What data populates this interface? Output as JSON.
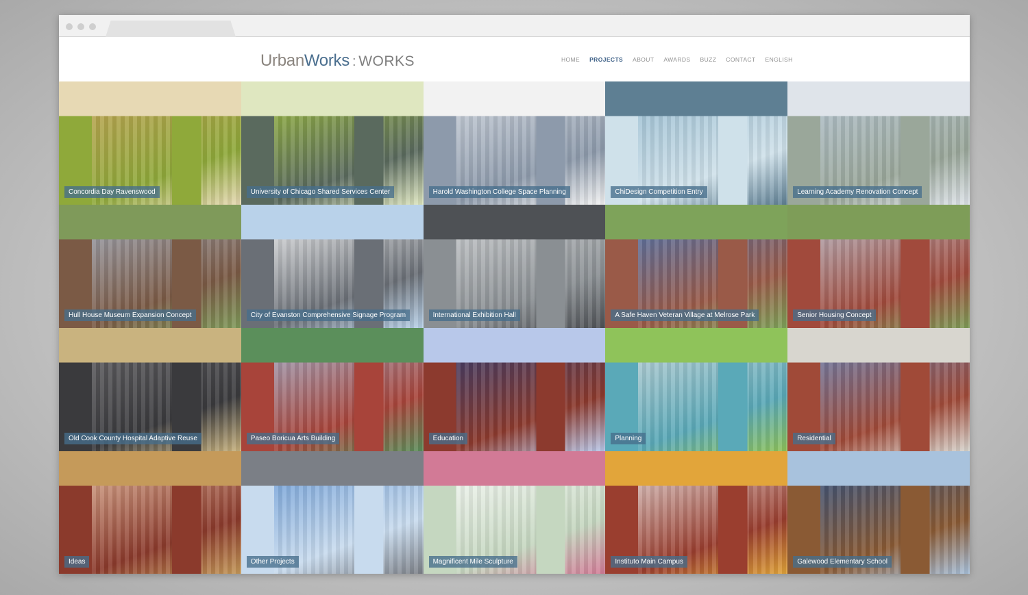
{
  "header": {
    "logo_urban": "Urban",
    "logo_works": "Works",
    "logo_sep": ":",
    "logo_sub": "WORKS"
  },
  "nav": [
    {
      "label": "HOME",
      "active": false
    },
    {
      "label": "PROJECTS",
      "active": true
    },
    {
      "label": "ABOUT",
      "active": false
    },
    {
      "label": "AWARDS",
      "active": false
    },
    {
      "label": "BUZZ",
      "active": false
    },
    {
      "label": "CONTACT",
      "active": false
    },
    {
      "label": "ENGLISH",
      "active": false
    }
  ],
  "projects": [
    {
      "label": "Concordia Day Ravenswood",
      "icon": "interior-classroom-image",
      "colors": [
        "#c9a15a",
        "#8fa93a",
        "#e7d9b4"
      ]
    },
    {
      "label": "University of Chicago Shared Services Center",
      "icon": "interior-office-image",
      "colors": [
        "#a6c83a",
        "#5a6a5e",
        "#dfe7c0"
      ]
    },
    {
      "label": "Harold Washington College Space Planning",
      "icon": "tower-building-image",
      "colors": [
        "#d8dde4",
        "#8d9aab",
        "#f2f2f2"
      ]
    },
    {
      "label": "ChiDesign Competition Entry",
      "icon": "plaza-rendering-image",
      "colors": [
        "#8fb6cc",
        "#cfe1ea",
        "#5e7f93"
      ]
    },
    {
      "label": "Learning Academy Renovation Concept",
      "icon": "school-building-image",
      "colors": [
        "#b7c7d8",
        "#9aa79a",
        "#dfe4ea"
      ]
    },
    {
      "label": "Hull House Museum Expansion Concept",
      "icon": "museum-building-image",
      "colors": [
        "#a3b3c8",
        "#7b5a45",
        "#7f9a5a"
      ]
    },
    {
      "label": "City of Evanston Comprehensive Signage Program",
      "icon": "signage-drawing-image",
      "colors": [
        "#ffffff",
        "#6a6f76",
        "#b9d2ea"
      ]
    },
    {
      "label": "International Exhibition Hall",
      "icon": "exhibition-hall-image",
      "colors": [
        "#d6d8da",
        "#8a8f93",
        "#4e5155"
      ]
    },
    {
      "label": "A Safe Haven Veteran Village at Melrose Park",
      "icon": "housing-village-image",
      "colors": [
        "#3f79c2",
        "#9a5a48",
        "#7ea35a"
      ]
    },
    {
      "label": "Senior Housing Concept",
      "icon": "senior-housing-image",
      "colors": [
        "#b8c6d6",
        "#a14a3c",
        "#7e9d58"
      ]
    },
    {
      "label": "Old Cook County Hospital Adaptive Reuse",
      "icon": "hospital-aerial-image",
      "colors": [
        "#6b6a6d",
        "#3a3a3d",
        "#c9b37f"
      ]
    },
    {
      "label": "Paseo Boricua Arts Building",
      "icon": "arts-building-image",
      "colors": [
        "#9fbfe0",
        "#a8443a",
        "#5b8f5b"
      ]
    },
    {
      "label": "Education",
      "icon": "education-building-image",
      "colors": [
        "#253d7a",
        "#8c3a2e",
        "#b8c8ea"
      ]
    },
    {
      "label": "Planning",
      "icon": "city-plan-image",
      "colors": [
        "#d4d9dc",
        "#5aa9b8",
        "#8fc35a"
      ]
    },
    {
      "label": "Residential",
      "icon": "residential-building-image",
      "colors": [
        "#5b8bc9",
        "#a04a38",
        "#d8d6cf"
      ]
    },
    {
      "label": "Ideas",
      "icon": "ideas-street-image",
      "colors": [
        "#e9c3a6",
        "#8b3a2c",
        "#c59a5a"
      ]
    },
    {
      "label": "Other Projects",
      "icon": "fountain-skyline-image",
      "colors": [
        "#5a8fd0",
        "#c8dbee",
        "#7b7f86"
      ]
    },
    {
      "label": "Magnificent Mile Sculpture",
      "icon": "sculpture-model-image",
      "colors": [
        "#ffffff",
        "#c5d7c0",
        "#d27a96"
      ]
    },
    {
      "label": "Instituto Main Campus",
      "icon": "campus-building-image",
      "colors": [
        "#e9e9e9",
        "#9a3e2f",
        "#e2a53a"
      ]
    },
    {
      "label": "Galewood Elementary School",
      "icon": "elementary-school-image",
      "colors": [
        "#1f4f8f",
        "#8a5a34",
        "#a8c2dd"
      ]
    }
  ]
}
